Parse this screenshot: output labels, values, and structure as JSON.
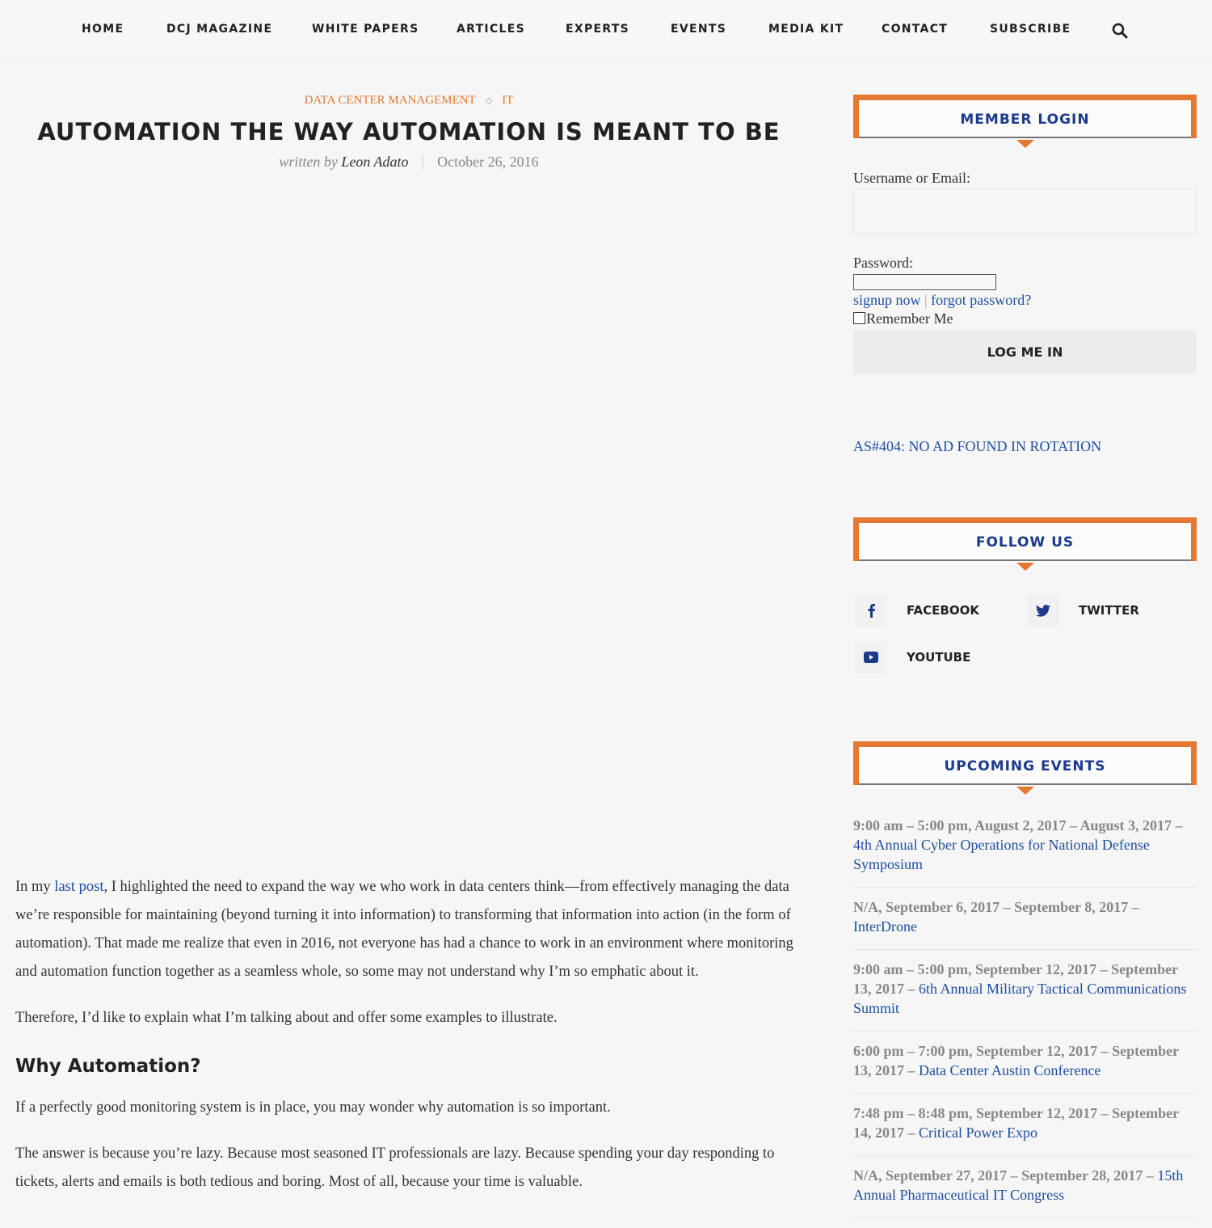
{
  "nav": {
    "items": [
      "HOME",
      "DCJ MAGAZINE",
      "WHITE PAPERS",
      "ARTICLES",
      "EXPERTS",
      "EVENTS",
      "MEDIA KIT",
      "CONTACT",
      "SUBSCRIBE"
    ],
    "search_icon": "search-icon"
  },
  "post": {
    "categories": [
      "DATA CENTER MANAGEMENT",
      "IT"
    ],
    "category_separator": "◇",
    "title": "AUTOMATION THE WAY AUTOMATION IS MEANT TO BE",
    "written_by": "written by",
    "author": "Leon Adato",
    "date": "October 26, 2016",
    "p1_before": "In my ",
    "p1_link": "last post",
    "p1_after": ", I highlighted the need to expand the way we who work in data centers think—from effectively managing the data we’re responsible for maintaining (beyond turning it into information) to transforming that information into action (in the form of automation). That made me realize that even in 2016, not everyone has had a chance to work in an environment where monitoring and automation function together as a seamless whole, so some may not understand why I’m so emphatic about it.",
    "p2": "Therefore, I’d like to explain what I’m talking about and offer some examples to illustrate.",
    "h2": "Why Automation?",
    "p3": "If a perfectly good monitoring system is in place, you may wonder why automation is so important.",
    "p4": "The answer is because you’re lazy. Because most seasoned IT professionals are lazy. Because spending your day responding to tickets, alerts and emails is both tedious and boring. Most of all, because your time is valuable."
  },
  "sidebar": {
    "login": {
      "title": "MEMBER LOGIN",
      "username_label": "Username or Email:",
      "username_value": "",
      "password_label": "Password:",
      "password_value": "",
      "signup": "signup now",
      "pipe": "|",
      "forgot": "forgot password?",
      "remember": "Remember Me",
      "remember_checked": false,
      "button": "LOG ME IN"
    },
    "ad": "AS#404: NO AD FOUND IN ROTATION",
    "follow": {
      "title": "FOLLOW US",
      "items": [
        {
          "label": "FACEBOOK",
          "icon": "facebook-icon"
        },
        {
          "label": "TWITTER",
          "icon": "twitter-icon"
        },
        {
          "label": "YOUTUBE",
          "icon": "youtube-icon"
        }
      ]
    },
    "events": {
      "title": "UPCOMING EVENTS",
      "items": [
        {
          "when": "9:00 am – 5:00 pm, August 2, 2017 – August 3, 2017 – ",
          "name": "4th Annual Cyber Operations for National Defense Symposium"
        },
        {
          "when": "N/A, September 6, 2017 – September 8, 2017 – ",
          "name": "InterDrone"
        },
        {
          "when": "9:00 am – 5:00 pm, September 12, 2017 – September 13, 2017 – ",
          "name": "6th Annual Military Tactical Communications Summit"
        },
        {
          "when": "6:00 pm – 7:00 pm, September 12, 2017 – September 13, 2017 – ",
          "name": "Data Center Austin Conference"
        },
        {
          "when": "7:48 pm – 8:48 pm, September 12, 2017 – September 14, 2017 – ",
          "name": "Critical Power Expo"
        },
        {
          "when": "N/A, September 27, 2017 – September 28, 2017 – ",
          "name": "15th Annual Pharmaceutical IT Congress"
        }
      ]
    }
  },
  "colors": {
    "accent": "#e27832",
    "link": "#1f4ea0",
    "widget_title": "#1b3a8c"
  }
}
